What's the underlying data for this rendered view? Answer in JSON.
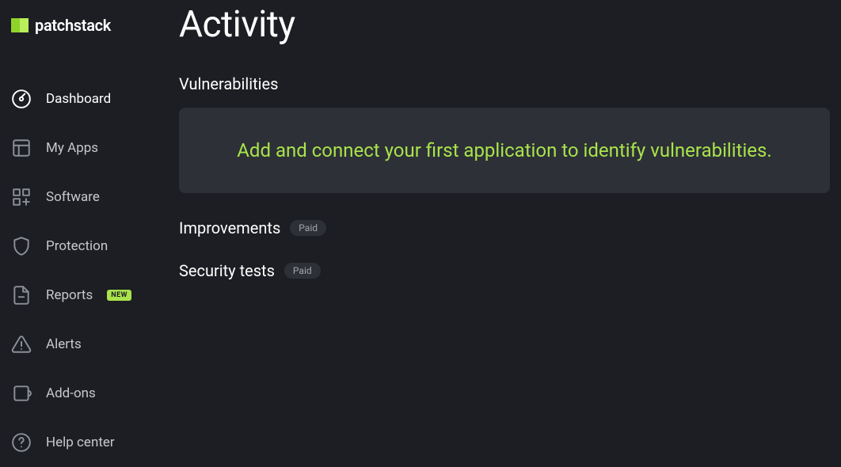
{
  "logo_text": "patchstack",
  "sidebar": {
    "items": [
      {
        "label": "Dashboard"
      },
      {
        "label": "My Apps"
      },
      {
        "label": "Software"
      },
      {
        "label": "Protection"
      },
      {
        "label": "Reports",
        "badge": "NEW"
      },
      {
        "label": "Alerts"
      },
      {
        "label": "Add-ons"
      },
      {
        "label": "Help center"
      }
    ]
  },
  "page": {
    "title": "Activity",
    "sections": {
      "vulnerabilities": {
        "heading": "Vulnerabilities",
        "empty_message": "Add and connect your first application to identify vulnerabilities."
      },
      "improvements": {
        "heading": "Improvements",
        "badge": "Paid"
      },
      "security_tests": {
        "heading": "Security tests",
        "badge": "Paid"
      }
    }
  }
}
